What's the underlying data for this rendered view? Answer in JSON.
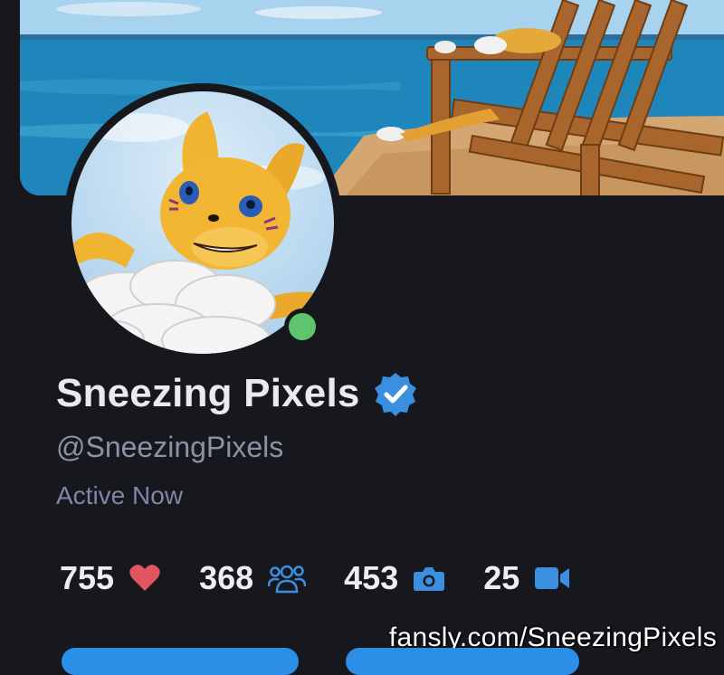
{
  "profile": {
    "display_name": "Sneezing Pixels",
    "handle": "@SneezingPixels",
    "status": "Active Now",
    "verified": true
  },
  "stats": [
    {
      "value": "755",
      "icon": "heart-icon",
      "color": "#e05560"
    },
    {
      "value": "368",
      "icon": "subscribers-icon",
      "color": "#3b8fe0"
    },
    {
      "value": "453",
      "icon": "camera-icon",
      "color": "#3b8fe0"
    },
    {
      "value": "25",
      "icon": "video-icon",
      "color": "#3b8fe0"
    }
  ],
  "watermark": "fansly.com/SneezingPixels",
  "colors": {
    "background": "#16181d",
    "accent": "#2b8fe8",
    "online": "#5fc46e",
    "verified_badge": "#3b8fe0"
  }
}
